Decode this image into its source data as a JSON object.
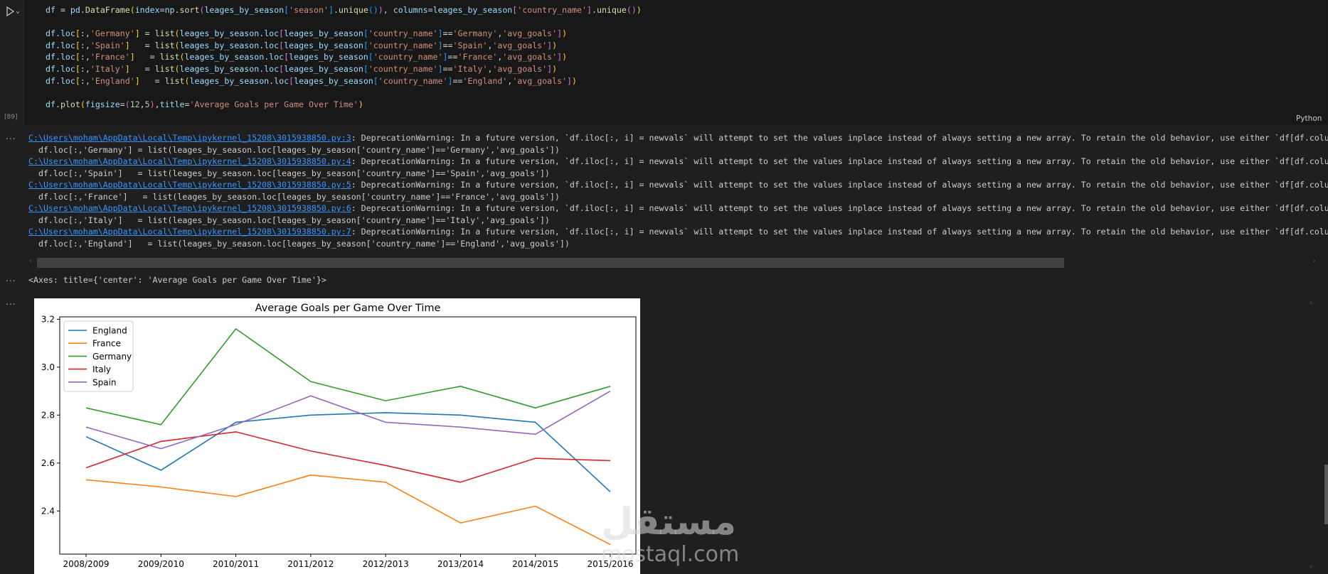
{
  "cell": {
    "exec_count": "[89]",
    "language": "Python",
    "run_icon": "play-icon",
    "menu_icon": "chevron-down-icon"
  },
  "code_lines": [
    "df = pd.DataFrame(index=np.sort(leages_by_season['season'].unique()), columns=leages_by_season['country_name'].unique())",
    "",
    "df.loc[:,'Germany'] = list(leages_by_season.loc[leages_by_season['country_name']=='Germany','avg_goals'])",
    "df.loc[:,'Spain']   = list(leages_by_season.loc[leages_by_season['country_name']=='Spain','avg_goals'])",
    "df.loc[:,'France']   = list(leages_by_season.loc[leages_by_season['country_name']=='France','avg_goals'])",
    "df.loc[:,'Italy']   = list(leages_by_season.loc[leages_by_season['country_name']=='Italy','avg_goals'])",
    "df.loc[:,'England']   = list(leages_by_season.loc[leages_by_season['country_name']=='England','avg_goals'])",
    "",
    "df.plot(figsize=(12,5),title='Average Goals per Game Over Time')"
  ],
  "warnings": [
    {
      "link": "C:\\Users\\moham\\AppData\\Local\\Temp\\ipykernel_15208\\3015938850.py:3",
      "message": ": DeprecationWarning: In a future version, `df.iloc[:, i] = newvals` will attempt to set the values inplace instead of always setting a new array. To retain the old behavior, use either `df[df.columns[i]] =",
      "code": "  df.loc[:,'Germany'] = list(leages_by_season.loc[leages_by_season['country_name']=='Germany','avg_goals'])"
    },
    {
      "link": "C:\\Users\\moham\\AppData\\Local\\Temp\\ipykernel_15208\\3015938850.py:4",
      "message": ": DeprecationWarning: In a future version, `df.iloc[:, i] = newvals` will attempt to set the values inplace instead of always setting a new array. To retain the old behavior, use either `df[df.columns[i]] =",
      "code": "  df.loc[:,'Spain']   = list(leages_by_season.loc[leages_by_season['country_name']=='Spain','avg_goals'])"
    },
    {
      "link": "C:\\Users\\moham\\AppData\\Local\\Temp\\ipykernel_15208\\3015938850.py:5",
      "message": ": DeprecationWarning: In a future version, `df.iloc[:, i] = newvals` will attempt to set the values inplace instead of always setting a new array. To retain the old behavior, use either `df[df.columns[i]] =",
      "code": "  df.loc[:,'France']   = list(leages_by_season.loc[leages_by_season['country_name']=='France','avg_goals'])"
    },
    {
      "link": "C:\\Users\\moham\\AppData\\Local\\Temp\\ipykernel_15208\\3015938850.py:6",
      "message": ": DeprecationWarning: In a future version, `df.iloc[:, i] = newvals` will attempt to set the values inplace instead of always setting a new array. To retain the old behavior, use either `df[df.columns[i]] =",
      "code": "  df.loc[:,'Italy']   = list(leages_by_season.loc[leages_by_season['country_name']=='Italy','avg_goals'])"
    },
    {
      "link": "C:\\Users\\moham\\AppData\\Local\\Temp\\ipykernel_15208\\3015938850.py:7",
      "message": ": DeprecationWarning: In a future version, `df.iloc[:, i] = newvals` will attempt to set the values inplace instead of always setting a new array. To retain the old behavior, use either `df[df.columns[i]] =",
      "code": "  df.loc[:,'England']   = list(leages_by_season.loc[leages_by_season['country_name']=='England','avg_goals'])"
    }
  ],
  "output_dots": "...",
  "axes_repr": "<Axes: title={'center': 'Average Goals per Game Over Time'}>",
  "chart_data": {
    "type": "line",
    "title": "Average Goals per Game Over Time",
    "xlabel": "",
    "ylabel": "",
    "categories": [
      "2008/2009",
      "2009/2010",
      "2010/2011",
      "2011/2012",
      "2012/2013",
      "2013/2014",
      "2014/2015",
      "2015/2016"
    ],
    "ylim": [
      2.22,
      3.21
    ],
    "yticks": [
      "2.4",
      "2.6",
      "2.8",
      "3.0",
      "3.2"
    ],
    "ytick_values": [
      2.4,
      2.6,
      2.8,
      3.0,
      3.2
    ],
    "legend_position": "upper-left",
    "grid": false,
    "series": [
      {
        "name": "England",
        "color": "#1f77b4",
        "values": [
          2.71,
          2.57,
          2.77,
          2.8,
          2.81,
          2.8,
          2.77,
          2.48
        ]
      },
      {
        "name": "France",
        "color": "#ff7f0e",
        "values": [
          2.53,
          2.5,
          2.46,
          2.55,
          2.52,
          2.35,
          2.42,
          2.26
        ]
      },
      {
        "name": "Germany",
        "color": "#2ca02c",
        "values": [
          2.83,
          2.76,
          3.16,
          2.94,
          2.86,
          2.92,
          2.83,
          2.92
        ]
      },
      {
        "name": "Italy",
        "color": "#d62728",
        "values": [
          2.58,
          2.69,
          2.73,
          2.65,
          2.59,
          2.52,
          2.62,
          2.61
        ]
      },
      {
        "name": "Spain",
        "color": "#9467bd",
        "values": [
          2.75,
          2.66,
          2.76,
          2.88,
          2.77,
          2.75,
          2.72,
          2.9
        ]
      }
    ]
  },
  "watermark": {
    "arabic": "مستقل",
    "latin": "mostaql.com"
  }
}
